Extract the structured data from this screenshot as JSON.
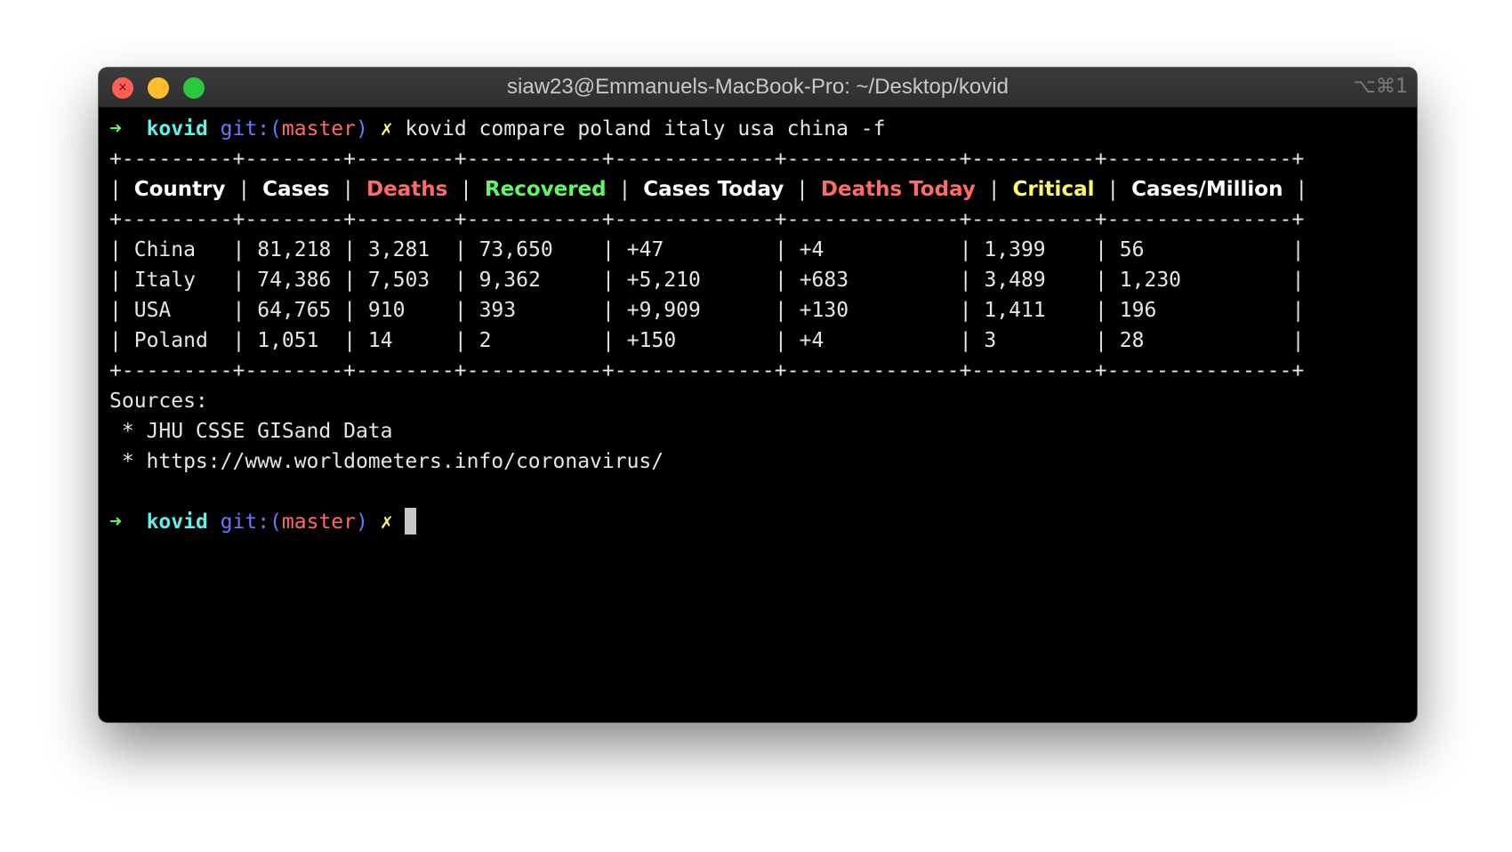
{
  "window": {
    "title": "siaw23@Emmanuels-MacBook-Pro: ~/Desktop/kovid",
    "shortcut": "⌥⌘1"
  },
  "prompt": {
    "arrow": "➜",
    "dir": "kovid",
    "git_prefix": "git:(",
    "branch": "master",
    "git_suffix": ")",
    "dirty": "✗"
  },
  "command": "kovid compare poland italy usa china -f",
  "table": {
    "headers": [
      "Country",
      "Cases",
      "Deaths",
      "Recovered",
      "Cases Today",
      "Deaths Today",
      "Critical",
      "Cases/Million"
    ],
    "header_colors": [
      "#ffffff",
      "#ffffff",
      "#ff6b68",
      "#5ff967",
      "#ffffff",
      "#ff6b68",
      "#fefb67",
      "#ffffff"
    ],
    "rows": [
      [
        "China",
        "81,218",
        "3,281",
        "73,650",
        "+47",
        "+4",
        "1,399",
        "56"
      ],
      [
        "Italy",
        "74,386",
        "7,503",
        "9,362",
        "+5,210",
        "+683",
        "3,489",
        "1,230"
      ],
      [
        "USA",
        "64,765",
        "910",
        "393",
        "+9,909",
        "+130",
        "1,411",
        "196"
      ],
      [
        "Poland",
        "1,051",
        "14",
        "2",
        "+150",
        "+4",
        "3",
        "28"
      ]
    ]
  },
  "sources": {
    "label": "Sources:",
    "items": [
      " * JHU CSSE GISand Data",
      " * https://www.worldometers.info/coronavirus/"
    ]
  },
  "colors": {
    "prompt_arrow": "#5ff967",
    "prompt_dir": "#60f0e9",
    "git": "#6a76fb",
    "branch": "#ff6b68",
    "dirty": "#fefb67"
  }
}
